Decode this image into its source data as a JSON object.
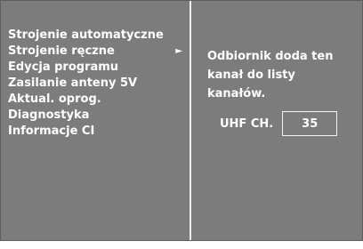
{
  "menu": {
    "items": [
      {
        "label": "Strojenie automatyczne",
        "selected": false
      },
      {
        "label": "Strojenie ręczne",
        "selected": true,
        "arrow": "►"
      },
      {
        "label": "Edycja programu",
        "selected": false
      },
      {
        "label": "Zasilanie anteny 5V",
        "selected": false
      },
      {
        "label": "Aktual. oprog.",
        "selected": false
      },
      {
        "label": "Diagnostyka",
        "selected": false
      },
      {
        "label": "Informacje CI",
        "selected": false
      }
    ]
  },
  "info": {
    "message": "Odbiornik doda ten\nkanał do listy\nkanałów.",
    "channel_label": "UHF CH.",
    "channel_value": "35"
  },
  "colors": {
    "panel_background": "#7c7c7c",
    "text": "#ffffff",
    "divider": "#ededed"
  }
}
